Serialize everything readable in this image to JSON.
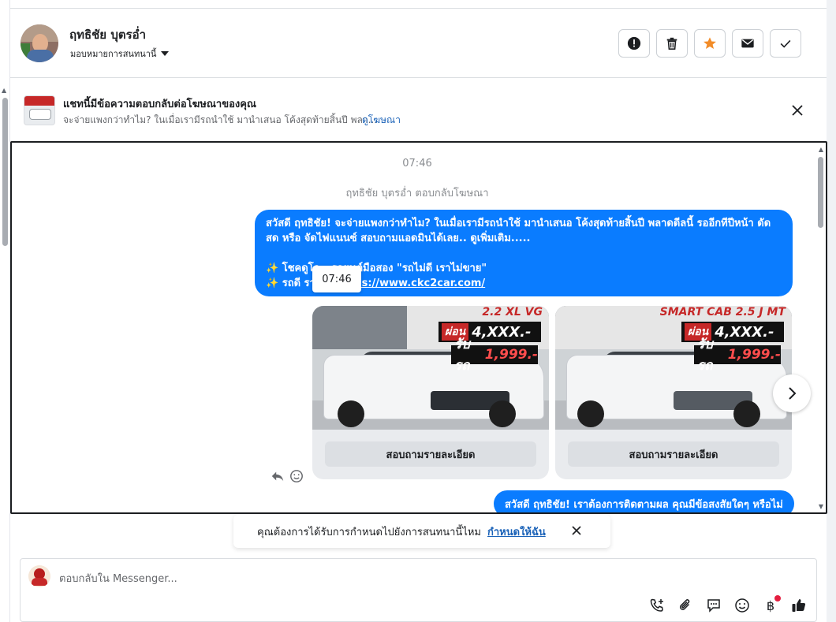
{
  "header": {
    "contact_name": "ฤทธิชัย บุตรอ่ำ",
    "assign_label": "มอบหมายการสนทนานี้",
    "buttons": [
      "report-icon",
      "trash-icon",
      "star-icon",
      "mail-icon",
      "check-icon"
    ],
    "star_color": "#f28c28"
  },
  "ad_banner": {
    "title": "แชทนี้มีข้อความตอบกลับต่อโฆษณาของคุณ",
    "subtitle": "จะจ่ายแพงกว่าทำไม? ในเมื่อเรามีรถนำใช้ มานำเสนอ โค้งสุดท้ายสิ้นปี พลา...",
    "link": "ดูโฆษณา"
  },
  "chat": {
    "time": "07:46",
    "reply_note": "ฤทธิชัย บุตรอ่ำ ตอบกลับโฆษณา",
    "message1": {
      "line1": "สวัสดี ฤทธิชัย! จะจ่ายแพงกว่าทำไม? ในเมื่อเรามีรถนำใช้ มานำเสนอ โค้งสุดท้ายสิ้นปี พลาดดีลนี้ รออีกทีปีหน้า ดัด",
      "line2": "สด หรือ จัดไฟแนนซ์ สอบถามแอดมินได้เลย.. ดูเพิ่มเติม.....",
      "line3": "✨ โชคดูโอ...รถยนต์มือสอง \"รถไม่ดี เราไม่ขาย\"",
      "line4_prefix": "✨ รถดี รา...ดี ",
      "link": "https://www.ckc2car.com/"
    },
    "tooltip_time": "07:46",
    "cards": [
      {
        "model": "2.2 XL VG",
        "installment_label": "ผ่อน",
        "installment": "4,XXX.-",
        "down_label": "รับรถ",
        "down": "1,999.-",
        "button": "สอบถามรายละเอียด"
      },
      {
        "model": "SMART CAB 2.5 J MT",
        "installment_label": "ผ่อน",
        "installment": "4,XXX.-",
        "down_label": "รับรถ",
        "down": "1,999.-",
        "button": "สอบถามรายละเอียด"
      }
    ],
    "message2": "สวัสดี ฤทธิชัย! เราต้องการติดตามผล คุณมีข้อสงสัยใดๆ หรือไม่"
  },
  "followup": {
    "text": "คุณต้องการได้รับการกำหนดไปยังการสนทนานี้ไหม",
    "link": "กำหนดให้ฉัน"
  },
  "composer": {
    "placeholder": "ตอบกลับใน Messenger...",
    "tools": [
      "phone-add-icon",
      "paperclip-icon",
      "saved-reply-icon",
      "emoji-icon",
      "baht-icon",
      "thumbs-up-icon"
    ],
    "baht_symbol": "฿"
  },
  "colors": {
    "accent": "#0a7cff",
    "link": "#1a62b8"
  }
}
